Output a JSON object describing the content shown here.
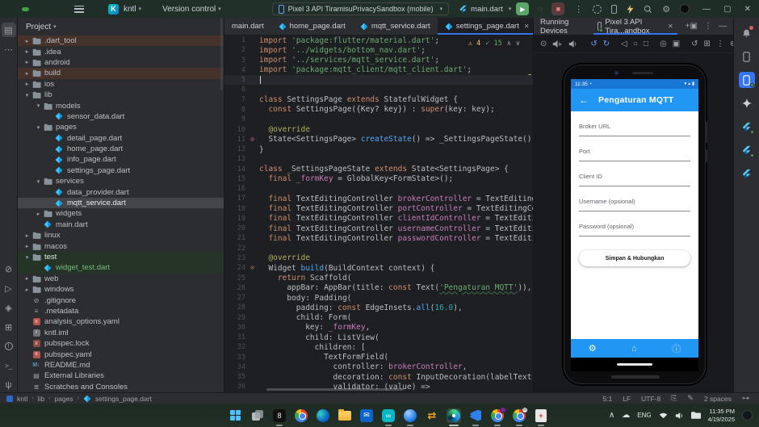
{
  "colors": {
    "accent": "#3574f0",
    "phone_blue": "#2196f3",
    "phone_status_blue": "#1976d2",
    "run_green": "#59a869",
    "stop_red": "#db5c5c",
    "vcs_green": "#73bd79",
    "warn_yellow": "#f2c55c"
  },
  "titlebar": {
    "project_name": "kntl",
    "vcs_label": "Version control",
    "device_selector": "Pixel 3 API TiramisuPrivacySandbox (mobile)",
    "run_config": "main.dart",
    "window_controls": {
      "minimize": "—",
      "maximize": "▢",
      "close": "✕"
    }
  },
  "left_stripe": [
    {
      "name": "project-tool-icon",
      "glyph": "▤",
      "active": true
    },
    {
      "name": "more-tools-icon",
      "glyph": "⋯",
      "active": false
    }
  ],
  "left_stripe_bottom": [
    {
      "name": "commit-icon",
      "glyph": "⊘"
    },
    {
      "name": "run-tool-icon",
      "glyph": "▷"
    },
    {
      "name": "structure-icon",
      "glyph": "◈"
    },
    {
      "name": "logcat-icon",
      "glyph": "⊞"
    },
    {
      "name": "problems-icon",
      "glyph": "!"
    },
    {
      "name": "terminal-icon",
      "glyph": ">_"
    },
    {
      "name": "git-icon",
      "glyph": "ψ"
    }
  ],
  "project_panel": {
    "title": "Project",
    "tree": [
      {
        "label": ".dart_tool",
        "level": 1,
        "chevron": "r",
        "icon": "folder",
        "hl": "brown"
      },
      {
        "label": ".idea",
        "level": 1,
        "chevron": "r",
        "icon": "folder"
      },
      {
        "label": "android",
        "level": 1,
        "chevron": "r",
        "icon": "folder"
      },
      {
        "label": "build",
        "level": 1,
        "chevron": "r",
        "icon": "folder",
        "hl": "brown"
      },
      {
        "label": "ios",
        "level": 1,
        "chevron": "r",
        "icon": "folder"
      },
      {
        "label": "lib",
        "level": 1,
        "chevron": "d",
        "icon": "folder"
      },
      {
        "label": "models",
        "level": 2,
        "chevron": "d",
        "icon": "folder"
      },
      {
        "label": "sensor_data.dart",
        "level": 3,
        "chevron": "",
        "icon": "dart"
      },
      {
        "label": "pages",
        "level": 2,
        "chevron": "d",
        "icon": "folder"
      },
      {
        "label": "detail_page.dart",
        "level": 3,
        "chevron": "",
        "icon": "dart"
      },
      {
        "label": "home_page.dart",
        "level": 3,
        "chevron": "",
        "icon": "dart"
      },
      {
        "label": "info_page.dart",
        "level": 3,
        "chevron": "",
        "icon": "dart"
      },
      {
        "label": "settings_page.dart",
        "level": 3,
        "chevron": "",
        "icon": "dart"
      },
      {
        "label": "services",
        "level": 2,
        "chevron": "d",
        "icon": "folder"
      },
      {
        "label": "data_provider.dart",
        "level": 3,
        "chevron": "",
        "icon": "dart"
      },
      {
        "label": "mqtt_service.dart",
        "level": 3,
        "chevron": "",
        "icon": "dart",
        "hl": "sel"
      },
      {
        "label": "widgets",
        "level": 2,
        "chevron": "r",
        "icon": "folder"
      },
      {
        "label": "main.dart",
        "level": 2,
        "chevron": "",
        "icon": "dart"
      },
      {
        "label": "linux",
        "level": 1,
        "chevron": "r",
        "icon": "folder"
      },
      {
        "label": "macos",
        "level": 1,
        "chevron": "r",
        "icon": "folder"
      },
      {
        "label": "test",
        "level": 1,
        "chevron": "d",
        "icon": "folder",
        "hl": "green"
      },
      {
        "label": "widget_test.dart",
        "level": 2,
        "chevron": "",
        "icon": "dart",
        "hl": "green",
        "txt": "green"
      },
      {
        "label": "web",
        "level": 1,
        "chevron": "r",
        "icon": "folder"
      },
      {
        "label": "windows",
        "level": 1,
        "chevron": "r",
        "icon": "folder"
      },
      {
        "label": ".gitignore",
        "level": 1,
        "chevron": "",
        "icon": "ignore"
      },
      {
        "label": ".metadata",
        "level": 1,
        "chevron": "",
        "icon": "meta"
      },
      {
        "label": "analysis_options.yaml",
        "level": 1,
        "chevron": "",
        "icon": "yaml"
      },
      {
        "label": "kntl.iml",
        "level": 1,
        "chevron": "",
        "icon": "iml"
      },
      {
        "label": "pubspec.lock",
        "level": 1,
        "chevron": "",
        "icon": "lock"
      },
      {
        "label": "pubspec.yaml",
        "level": 1,
        "chevron": "",
        "icon": "yaml"
      },
      {
        "label": "README.md",
        "level": 1,
        "chevron": "",
        "icon": "md"
      },
      {
        "label": "External Libraries",
        "level": 1,
        "chevron": "",
        "icon": "extlib"
      },
      {
        "label": "Scratches and Consoles",
        "level": 1,
        "chevron": "",
        "icon": "scratch"
      }
    ]
  },
  "editor": {
    "tabs": [
      {
        "label": "main.dart",
        "icon": false,
        "active": false
      },
      {
        "label": "home_page.dart",
        "icon": true,
        "active": false
      },
      {
        "label": "mqtt_service.dart",
        "icon": true,
        "active": false
      },
      {
        "label": "settings_page.dart",
        "icon": true,
        "active": true,
        "closable": true
      }
    ],
    "warning_count": "4",
    "ok_count": "15",
    "current_line": 5,
    "override_lines": [
      11,
      24
    ],
    "lines": [
      "import 'package:flutter/material.dart';",
      "import '../widgets/bottom_nav.dart';",
      "import '../services/mqtt_service.dart';",
      "import 'package:mqtt_client/mqtt_client.dart';",
      "",
      "",
      "class SettingsPage extends StatefulWidget {",
      "  const SettingsPage({Key? key}) : super(key: key);",
      "",
      "  @override",
      "  State<SettingsPage> createState() => _SettingsPageState();",
      "}",
      "",
      "class _SettingsPageState extends State<SettingsPage> {",
      "  final _formKey = GlobalKey<FormState>();",
      "",
      "  final TextEditingController brokerController = TextEditingController();",
      "  final TextEditingController portController = TextEditingController();",
      "  final TextEditingController clientIdController = TextEditingController();",
      "  final TextEditingController usernameController = TextEditingController();",
      "  final TextEditingController passwordController = TextEditingController();",
      "",
      "  @override",
      "  Widget build(BuildContext context) {",
      "    return Scaffold(",
      "      appBar: AppBar(title: const Text('Pengaturan MQTT')),",
      "      body: Padding(",
      "        padding: const EdgeInsets.all(16.0),",
      "        child: Form(",
      "          key: _formKey,",
      "          child: ListView(",
      "            children: [",
      "              TextFormField(",
      "                controller: brokerController,",
      "                decoration: const InputDecoration(labelText: 'Broker URL'),",
      "                validator: (value) =>"
    ]
  },
  "running_devices": {
    "title": "Running Devices",
    "device_tab": "Pixel 3 API Tira...andbox",
    "toolbar": [
      {
        "name": "power-icon",
        "glyph": "⊙"
      },
      {
        "name": "volume-up-icon",
        "glyph": "spk+"
      },
      {
        "name": "volume-down-icon",
        "glyph": "spk-"
      },
      {
        "name": "sep"
      },
      {
        "name": "rotate-left-icon",
        "glyph": "↺",
        "blue": true
      },
      {
        "name": "rotate-right-icon",
        "glyph": "↻",
        "blue": true
      },
      {
        "name": "sep"
      },
      {
        "name": "back-icon",
        "glyph": "◁"
      },
      {
        "name": "home-icon",
        "glyph": "○"
      },
      {
        "name": "overview-icon",
        "glyph": "□"
      },
      {
        "name": "sep"
      },
      {
        "name": "screenshot-icon",
        "glyph": "◎"
      },
      {
        "name": "record-icon",
        "glyph": "▣"
      },
      {
        "name": "sep"
      },
      {
        "name": "snapshot-icon",
        "glyph": "↺"
      },
      {
        "name": "extend-icon",
        "glyph": "⊞"
      },
      {
        "name": "more-icon",
        "glyph": "⋮"
      }
    ],
    "toolbar_right": [
      {
        "name": "zoom-icon",
        "glyph": "⊕"
      },
      {
        "name": "fold-icon",
        "glyph": "▤"
      }
    ],
    "phone": {
      "status_time": "11:35",
      "app_title": "Pengaturan MQTT",
      "back_glyph": "←",
      "fields": [
        "Broker URL",
        "Port",
        "Client ID",
        "Username (opsional)",
        "Password (opsional)"
      ],
      "button_label": "Simpan & Hubungkan",
      "nav_icons": [
        {
          "name": "settings-nav-icon",
          "glyph": "⚙",
          "active": true
        },
        {
          "name": "home-nav-icon",
          "glyph": "⌂",
          "active": false
        },
        {
          "name": "info-nav-icon",
          "glyph": "ⓘ",
          "active": false
        }
      ]
    }
  },
  "right_stripe": [
    {
      "name": "notifications-icon",
      "type": "bell"
    },
    {
      "name": "device-explorer-icon",
      "type": "phone"
    },
    {
      "name": "running-devices-icon",
      "type": "phone",
      "active": true,
      "greendot": true
    },
    {
      "name": "gemini-icon",
      "type": "sparkle"
    },
    {
      "name": "flutter-outline-icon",
      "type": "flutter",
      "greendot": true
    },
    {
      "name": "flutter-performance-icon",
      "type": "flutter",
      "greendot": true
    },
    {
      "name": "flutter-inspector-icon",
      "type": "flutter",
      "greendot": false
    }
  ],
  "statusbar": {
    "breadcrumbs": [
      "kntl",
      "lib",
      "pages",
      "settings_page.dart"
    ],
    "caret_position": "5:1",
    "line_separator": "LF",
    "encoding": "UTF-8",
    "indent": "2 spaces"
  },
  "taskbar": {
    "icons": [
      {
        "name": "start-button",
        "type": "start"
      },
      {
        "name": "task-view-button",
        "type": "taskview"
      },
      {
        "name": "recorder-app",
        "type": "blacksq",
        "text": "8",
        "open": true
      },
      {
        "name": "chrome-app",
        "type": "chrome"
      },
      {
        "name": "edge-app",
        "type": "edge"
      },
      {
        "name": "file-explorer-app",
        "type": "folder"
      },
      {
        "name": "mail-app",
        "type": "mail",
        "text": "✉"
      },
      {
        "name": "capcut-app",
        "type": "inf",
        "text": "∞",
        "open": true
      },
      {
        "name": "browser-sphere-app",
        "type": "sphere",
        "open": true
      },
      {
        "name": "transfer-app",
        "type": "arrows",
        "text": "⇄"
      },
      {
        "name": "android-studio-app",
        "type": "studio",
        "open": true,
        "active": true
      },
      {
        "name": "vscode-app",
        "type": "vsc",
        "open": true
      },
      {
        "name": "chrome-profile1-app",
        "type": "chrome",
        "badge": "#7b1fa2",
        "open": true
      },
      {
        "name": "chrome-profile2-app",
        "type": "chrome",
        "badge": "#fff",
        "badgetext": "M",
        "open": true
      },
      {
        "name": "clipboard-app",
        "type": "clip",
        "text": "+",
        "open": true
      }
    ],
    "tray": {
      "chevron": "∧",
      "cloud": "☁",
      "lang": "ENG",
      "time": "11:35 PM",
      "date": "4/19/2025"
    }
  }
}
